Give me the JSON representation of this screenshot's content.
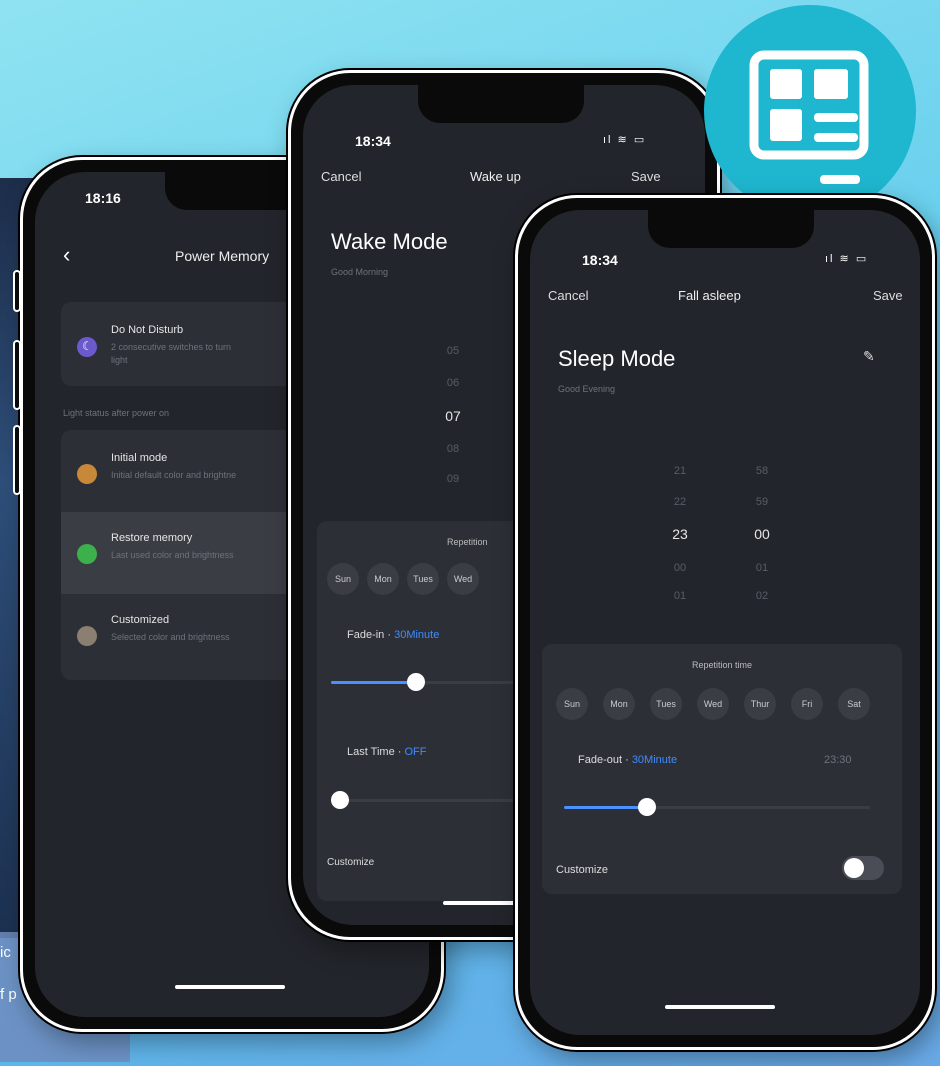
{
  "background": {
    "caption_line1": "ic",
    "caption_line2": "f p"
  },
  "colors": {
    "accent_blue": "#3f8cff",
    "screen_bg": "#22252b",
    "card_bg": "#2c2f36",
    "badge_teal": "#1fb6cf"
  },
  "badge": {
    "icon": "layout-icon"
  },
  "phone1": {
    "time": "18:16",
    "title": "Power Memory",
    "back_icon": "chevron-left-icon",
    "dnd": {
      "title": "Do Not Disturb",
      "desc": "2 consecutive switches to turn",
      "desc2": "light",
      "icon": "moon-icon"
    },
    "section_label": "Light status after power on",
    "options": [
      {
        "title": "Initial mode",
        "desc": "Initial default color and brightne",
        "icon": "bulb-icon",
        "color": "#c8883a"
      },
      {
        "title": "Restore memory",
        "desc": "Last used color and brightness",
        "icon": "memory-icon",
        "color": "#3cb04a"
      },
      {
        "title": "Customized",
        "desc": "Selected color and brightness",
        "icon": "custom-icon",
        "color": "#8a7f70"
      }
    ]
  },
  "phone2": {
    "time": "18:34",
    "status": "ıl ≋ ▭",
    "cancel": "Cancel",
    "title": "Wake up",
    "save": "Save",
    "mode_title": "Wake Mode",
    "greeting": "Good Morning",
    "hours": [
      "05",
      "06",
      "07",
      "08",
      "09"
    ],
    "repetition_label": "Repetition",
    "days": [
      "Sun",
      "Mon",
      "Tues",
      "Wed"
    ],
    "fade_label": "Fade-in · ",
    "fade_value": "30Minute",
    "fade_fraction": 0.5,
    "last_label": "Last Time · ",
    "last_value": "OFF",
    "customize": "Customize"
  },
  "phone3": {
    "time": "18:34",
    "status": "ıl ≋ ▭",
    "cancel": "Cancel",
    "title": "Fall asleep",
    "save": "Save",
    "mode_title": "Sleep Mode",
    "edit_icon": "edit-icon",
    "greeting": "Good Evening",
    "hours": [
      "21",
      "22",
      "23",
      "00",
      "01"
    ],
    "minutes": [
      "58",
      "59",
      "00",
      "01",
      "02"
    ],
    "repetition_label": "Repetition time",
    "days": [
      "Sun",
      "Mon",
      "Tues",
      "Wed",
      "Thur",
      "Fri",
      "Sat"
    ],
    "fade_label": "Fade-out · ",
    "fade_value": "30Minute",
    "fade_time": "23:30",
    "fade_fraction": 0.27,
    "customize": "Customize",
    "customize_on": false
  }
}
